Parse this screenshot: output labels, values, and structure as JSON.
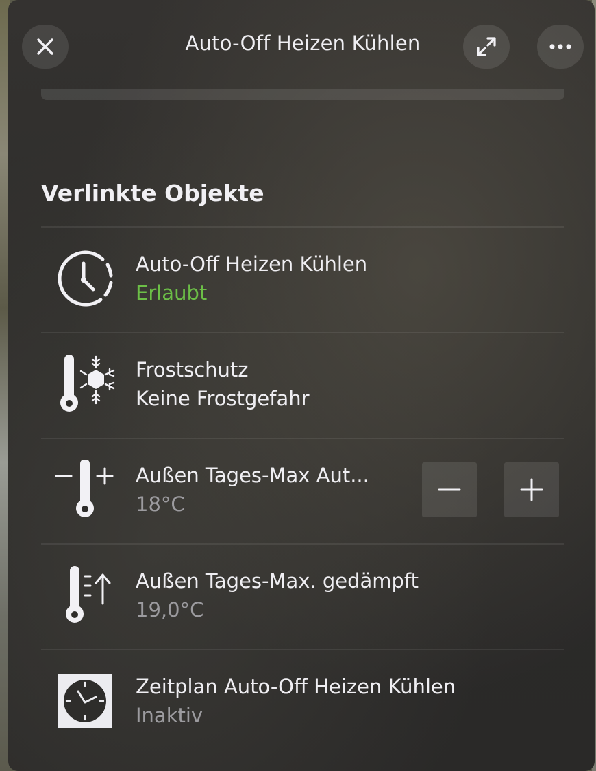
{
  "header": {
    "title": "Auto-Off Heizen Kühlen"
  },
  "section": {
    "title": "Verlinkte Objekte"
  },
  "rows": [
    {
      "label": "Auto-Off Heizen Kühlen",
      "value": "Erlaubt",
      "icon": "timer-icon",
      "value_color": "#6cbf47"
    },
    {
      "label": "Frostschutz",
      "value": "Keine Frostgefahr",
      "icon": "thermometer-snowflake-icon"
    },
    {
      "label": "Außen Tages-Max Aut...",
      "value": "18°C",
      "icon": "thermometer-plus-minus-icon"
    },
    {
      "label": "Außen Tages-Max. gedämpft",
      "value": "19,0°C",
      "icon": "thermometer-arrow-up-icon"
    },
    {
      "label": "Zeitplan Auto-Off Heizen Kühlen",
      "value": "Inaktiv",
      "icon": "schedule-clock-icon"
    }
  ],
  "colors": {
    "accent_green": "#6cbf47",
    "text_primary": "#efeef2",
    "text_secondary": "#9c9b9f"
  }
}
